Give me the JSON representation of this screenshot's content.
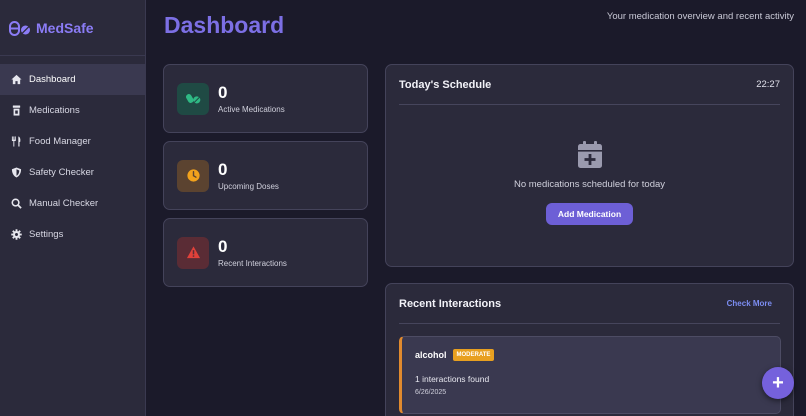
{
  "brand": {
    "name": "MedSafe"
  },
  "sidebar": {
    "items": [
      {
        "label": "Dashboard",
        "icon": "home-icon",
        "active": true
      },
      {
        "label": "Medications",
        "icon": "pill-bottle-icon",
        "active": false
      },
      {
        "label": "Food Manager",
        "icon": "utensils-icon",
        "active": false
      },
      {
        "label": "Safety Checker",
        "icon": "shield-icon",
        "active": false
      },
      {
        "label": "Manual Checker",
        "icon": "search-icon",
        "active": false
      },
      {
        "label": "Settings",
        "icon": "gear-icon",
        "active": false
      }
    ]
  },
  "header": {
    "title": "Dashboard",
    "subtitle": "Your medication overview and recent activity"
  },
  "stats": [
    {
      "value": "0",
      "label": "Active Medications",
      "icon": "pills-icon",
      "color": "#2fb984",
      "bg": "#1f4a44"
    },
    {
      "value": "0",
      "label": "Upcoming Doses",
      "icon": "clock-icon",
      "color": "#f2a21c",
      "bg": "#5b4330"
    },
    {
      "value": "0",
      "label": "Recent Interactions",
      "icon": "warning-icon",
      "color": "#e0413a",
      "bg": "#5a2c35"
    }
  ],
  "schedule": {
    "title": "Today's Schedule",
    "time": "22:27",
    "empty_text": "No medications scheduled for today",
    "add_button": "Add Medication"
  },
  "interactions": {
    "title": "Recent Interactions",
    "check_more": "Check More",
    "items": [
      {
        "name": "alcohol",
        "severity": "MODERATE",
        "count_text": "1 interactions found",
        "date": "6/26/2025"
      }
    ]
  },
  "fab": {
    "label": "+"
  },
  "colors": {
    "accent": "#7c6fe4",
    "background": "#1b1a2a",
    "card": "#2b2a3b",
    "moderate": "#e8a020"
  }
}
